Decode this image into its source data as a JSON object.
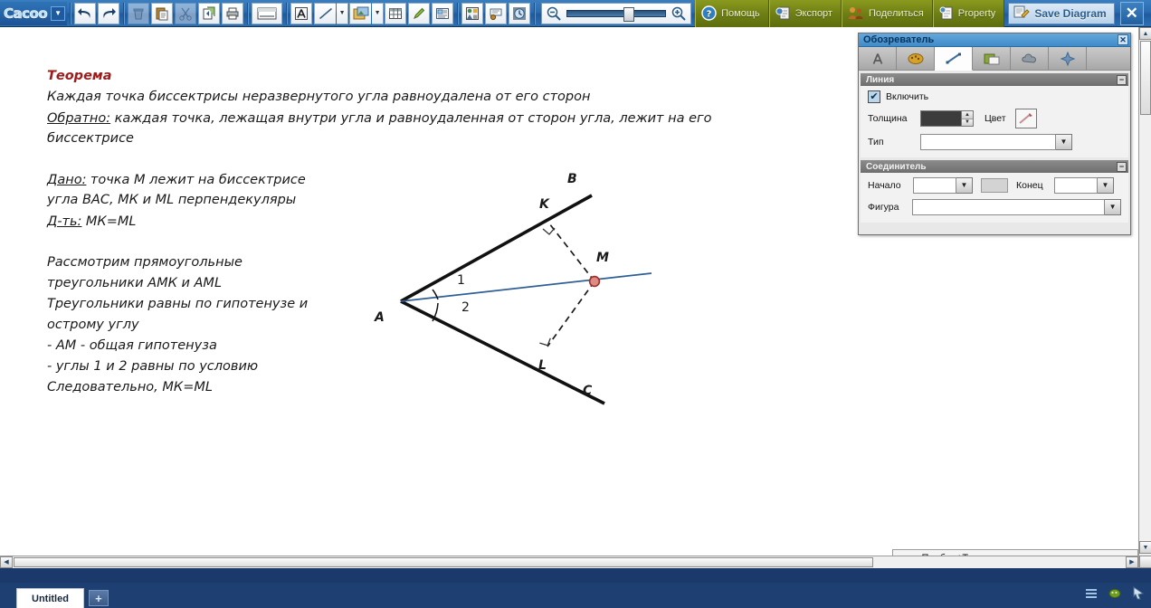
{
  "app": {
    "logo": "Cacoo",
    "logo_dropdown_icon": "chevron-down-icon"
  },
  "toolbar": {
    "buttons": [
      {
        "name": "undo-button",
        "icon": "undo-arrow-icon",
        "label": "Отменить"
      },
      {
        "name": "redo-button",
        "icon": "redo-arrow-icon",
        "label": "Вернуть"
      },
      {
        "name": "delete-button",
        "icon": "trash-can-icon",
        "label": "Удалить"
      },
      {
        "name": "paste-button",
        "icon": "clipboard-paste-icon",
        "label": "Вставить"
      },
      {
        "name": "cut-button",
        "icon": "scissors-icon",
        "label": "Вырезать"
      },
      {
        "name": "copy-button",
        "icon": "copy-pages-icon",
        "label": "Копировать"
      },
      {
        "name": "print-button",
        "icon": "printer-icon",
        "label": "Печать"
      },
      {
        "name": "background-button",
        "icon": "canvas-background-icon",
        "label": "Фон"
      },
      {
        "name": "text-button",
        "icon": "text-letter-a-icon",
        "label": "Текст"
      },
      {
        "name": "line-button",
        "icon": "diagonal-line-icon",
        "label": "Линия"
      },
      {
        "name": "line-options-button",
        "icon": "chevron-down-icon",
        "label": "Параметры линии"
      },
      {
        "name": "image-button",
        "icon": "picture-frame-icon",
        "label": "Изображение"
      },
      {
        "name": "image-options-button",
        "icon": "chevron-down-icon",
        "label": "Параметры изображения"
      },
      {
        "name": "table-button",
        "icon": "grid-table-icon",
        "label": "Таблица"
      },
      {
        "name": "pencil-button",
        "icon": "pencil-icon",
        "label": "Карандаш"
      },
      {
        "name": "note-button",
        "icon": "note-lines-icon",
        "label": "Заметка"
      },
      {
        "name": "stencil-button",
        "icon": "shapes-palette-icon",
        "label": "Шаблоны"
      },
      {
        "name": "comment-button",
        "icon": "speech-bubble-icon",
        "label": "Комментарий"
      },
      {
        "name": "revision-button",
        "icon": "history-clock-icon",
        "label": "История"
      }
    ],
    "zoom": {
      "zoom_out_icon": "magnifier-minus-icon",
      "zoom_in_icon": "magnifier-plus-icon",
      "slider_value": 56
    },
    "green_buttons": [
      {
        "name": "help-button",
        "icon": "question-mark-icon",
        "label": "Помощь"
      },
      {
        "name": "export-button",
        "icon": "export-page-icon",
        "label": "Экспорт"
      },
      {
        "name": "share-button",
        "icon": "people-group-icon",
        "label": "Поделиться"
      },
      {
        "name": "property-button",
        "icon": "document-info-icon",
        "label": "Property"
      }
    ],
    "save_button": {
      "icon": "save-pencil-icon",
      "label": "Save Diagram"
    },
    "close_button": {
      "icon": "close-x-icon",
      "label": "✕"
    }
  },
  "canvas": {
    "theorem": {
      "heading": "Теорема",
      "line1": "Каждая точка биссектрисы неразвернутого угла равноудалена от его сторон",
      "converse_label": "Обратно:",
      "converse_text": "каждая точка, лежащая внутри угла и равноудаленная от сторон угла, лежит на его",
      "converse_text2": "биссектрисе"
    },
    "given": {
      "given_label": "Дано:",
      "given_line1": "точка М лежит на биссектрисе",
      "given_line2": "угла ВАС, МК и ML перпендекуляры",
      "prove_label": "Д-ть:",
      "prove_text": "МК=ML"
    },
    "proof": {
      "line1": "Рассмотрим прямоугольные",
      "line2": "треугольники АМК и AML",
      "line3": "Треугольники равны по гипотенузе и",
      "line4": "острому углу",
      "line5": "- АМ - общая гипотенуза",
      "line6": "- углы 1 и 2 равны по условию",
      "line7": "Следовательно, МК=ML"
    },
    "diagram": {
      "labels": {
        "A": "A",
        "B": "B",
        "C": "C",
        "K": "K",
        "L": "L",
        "M": "M",
        "angle1": "1",
        "angle2": "2"
      },
      "colors": {
        "ray": "#111111",
        "bisector": "#2f5f96",
        "point_m_fill": "#e08a84",
        "point_m_stroke": "#9c2f28",
        "dashed": "#1a1a1a"
      }
    }
  },
  "panel": {
    "title": "Обозреватель",
    "close_icon": "close-x-icon",
    "tabs": [
      {
        "name": "panel-tab-text",
        "icon": "text-letter-a-icon",
        "active": false
      },
      {
        "name": "panel-tab-fill",
        "icon": "paint-palette-icon",
        "active": false
      },
      {
        "name": "panel-tab-line",
        "icon": "diagonal-line-icon",
        "active": true
      },
      {
        "name": "panel-tab-image",
        "icon": "picture-frame-icon",
        "active": false
      },
      {
        "name": "panel-tab-shape",
        "icon": "cloud-shape-icon",
        "active": false
      },
      {
        "name": "panel-tab-effect",
        "icon": "sparkle-star-icon",
        "active": false
      }
    ],
    "line_section": {
      "heading": "Линия",
      "collapse_icon": "minus-icon",
      "enable_label": "Включить",
      "enable_checked": true,
      "thickness_label": "Толщина",
      "thickness_value": "",
      "color_label": "Цвет",
      "color_swatch_icon": "line-color-icon",
      "type_label": "Тип",
      "type_value": "",
      "type_dropdown_icon": "chevron-down-icon"
    },
    "connector_section": {
      "heading": "Соединитель",
      "collapse_icon": "minus-icon",
      "start_label": "Начало",
      "start_value": "",
      "end_label": "Конец",
      "end_value": "",
      "shape_label": "Фигура",
      "shape_value": "",
      "dropdown_icon": "chevron-down-icon"
    }
  },
  "status": {
    "hint": "Пробел+Тащить прокручивает страницу.",
    "dropdown_icon": "chevron-down-icon"
  },
  "scrollbars": {
    "up_icon": "triangle-up-icon",
    "down_icon": "triangle-down-icon",
    "left_icon": "triangle-left-icon",
    "right_icon": "triangle-right-icon"
  },
  "bottom": {
    "document_tab": "Untitled",
    "add_tab_label": "+",
    "tray": [
      {
        "name": "tray-menu-icon",
        "icon": "hamburger-lines-icon"
      },
      {
        "name": "tray-status-icon",
        "icon": "green-badge-icon"
      },
      {
        "name": "tray-cursor-icon",
        "icon": "arrow-cursor-icon"
      }
    ]
  }
}
